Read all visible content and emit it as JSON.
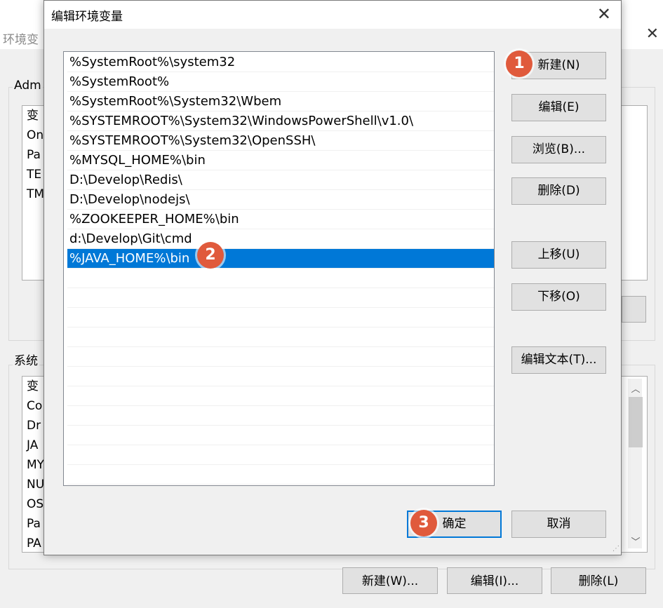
{
  "background_window": {
    "title": "环境变",
    "user_group_label": "Adm",
    "user_vars": [
      "变",
      "On",
      "Pa",
      "TE",
      "TM"
    ],
    "system_group_label": "系统",
    "system_vars": [
      "变",
      "Co",
      "Dr",
      "JA",
      "MY",
      "NU",
      "OS",
      "Pa",
      "PA"
    ],
    "buttons": {
      "new": "新建(W)...",
      "edit": "编辑(I)...",
      "delete": "删除(L)"
    }
  },
  "dialog": {
    "title": "编辑环境变量",
    "close_glyph": "✕",
    "path_entries": [
      "%SystemRoot%\\system32",
      "%SystemRoot%",
      "%SystemRoot%\\System32\\Wbem",
      "%SYSTEMROOT%\\System32\\WindowsPowerShell\\v1.0\\",
      "%SYSTEMROOT%\\System32\\OpenSSH\\",
      "%MYSQL_HOME%\\bin",
      "D:\\Develop\\Redis\\",
      "D:\\Develop\\nodejs\\",
      "%ZOOKEEPER_HOME%\\bin",
      "d:\\Develop\\Git\\cmd",
      "%JAVA_HOME%\\bin"
    ],
    "selected_index": 10,
    "buttons": {
      "new": "新建(N)",
      "edit": "编辑(E)",
      "browse": "浏览(B)...",
      "delete": "删除(D)",
      "move_up": "上移(U)",
      "move_down": "下移(O)",
      "edit_text": "编辑文本(T)...",
      "ok": "确定",
      "cancel": "取消"
    }
  },
  "annotations": {
    "step1": "1",
    "step2": "2",
    "step3": "3"
  },
  "colors": {
    "selection": "#0078d7",
    "badge": "#e05a3c"
  }
}
